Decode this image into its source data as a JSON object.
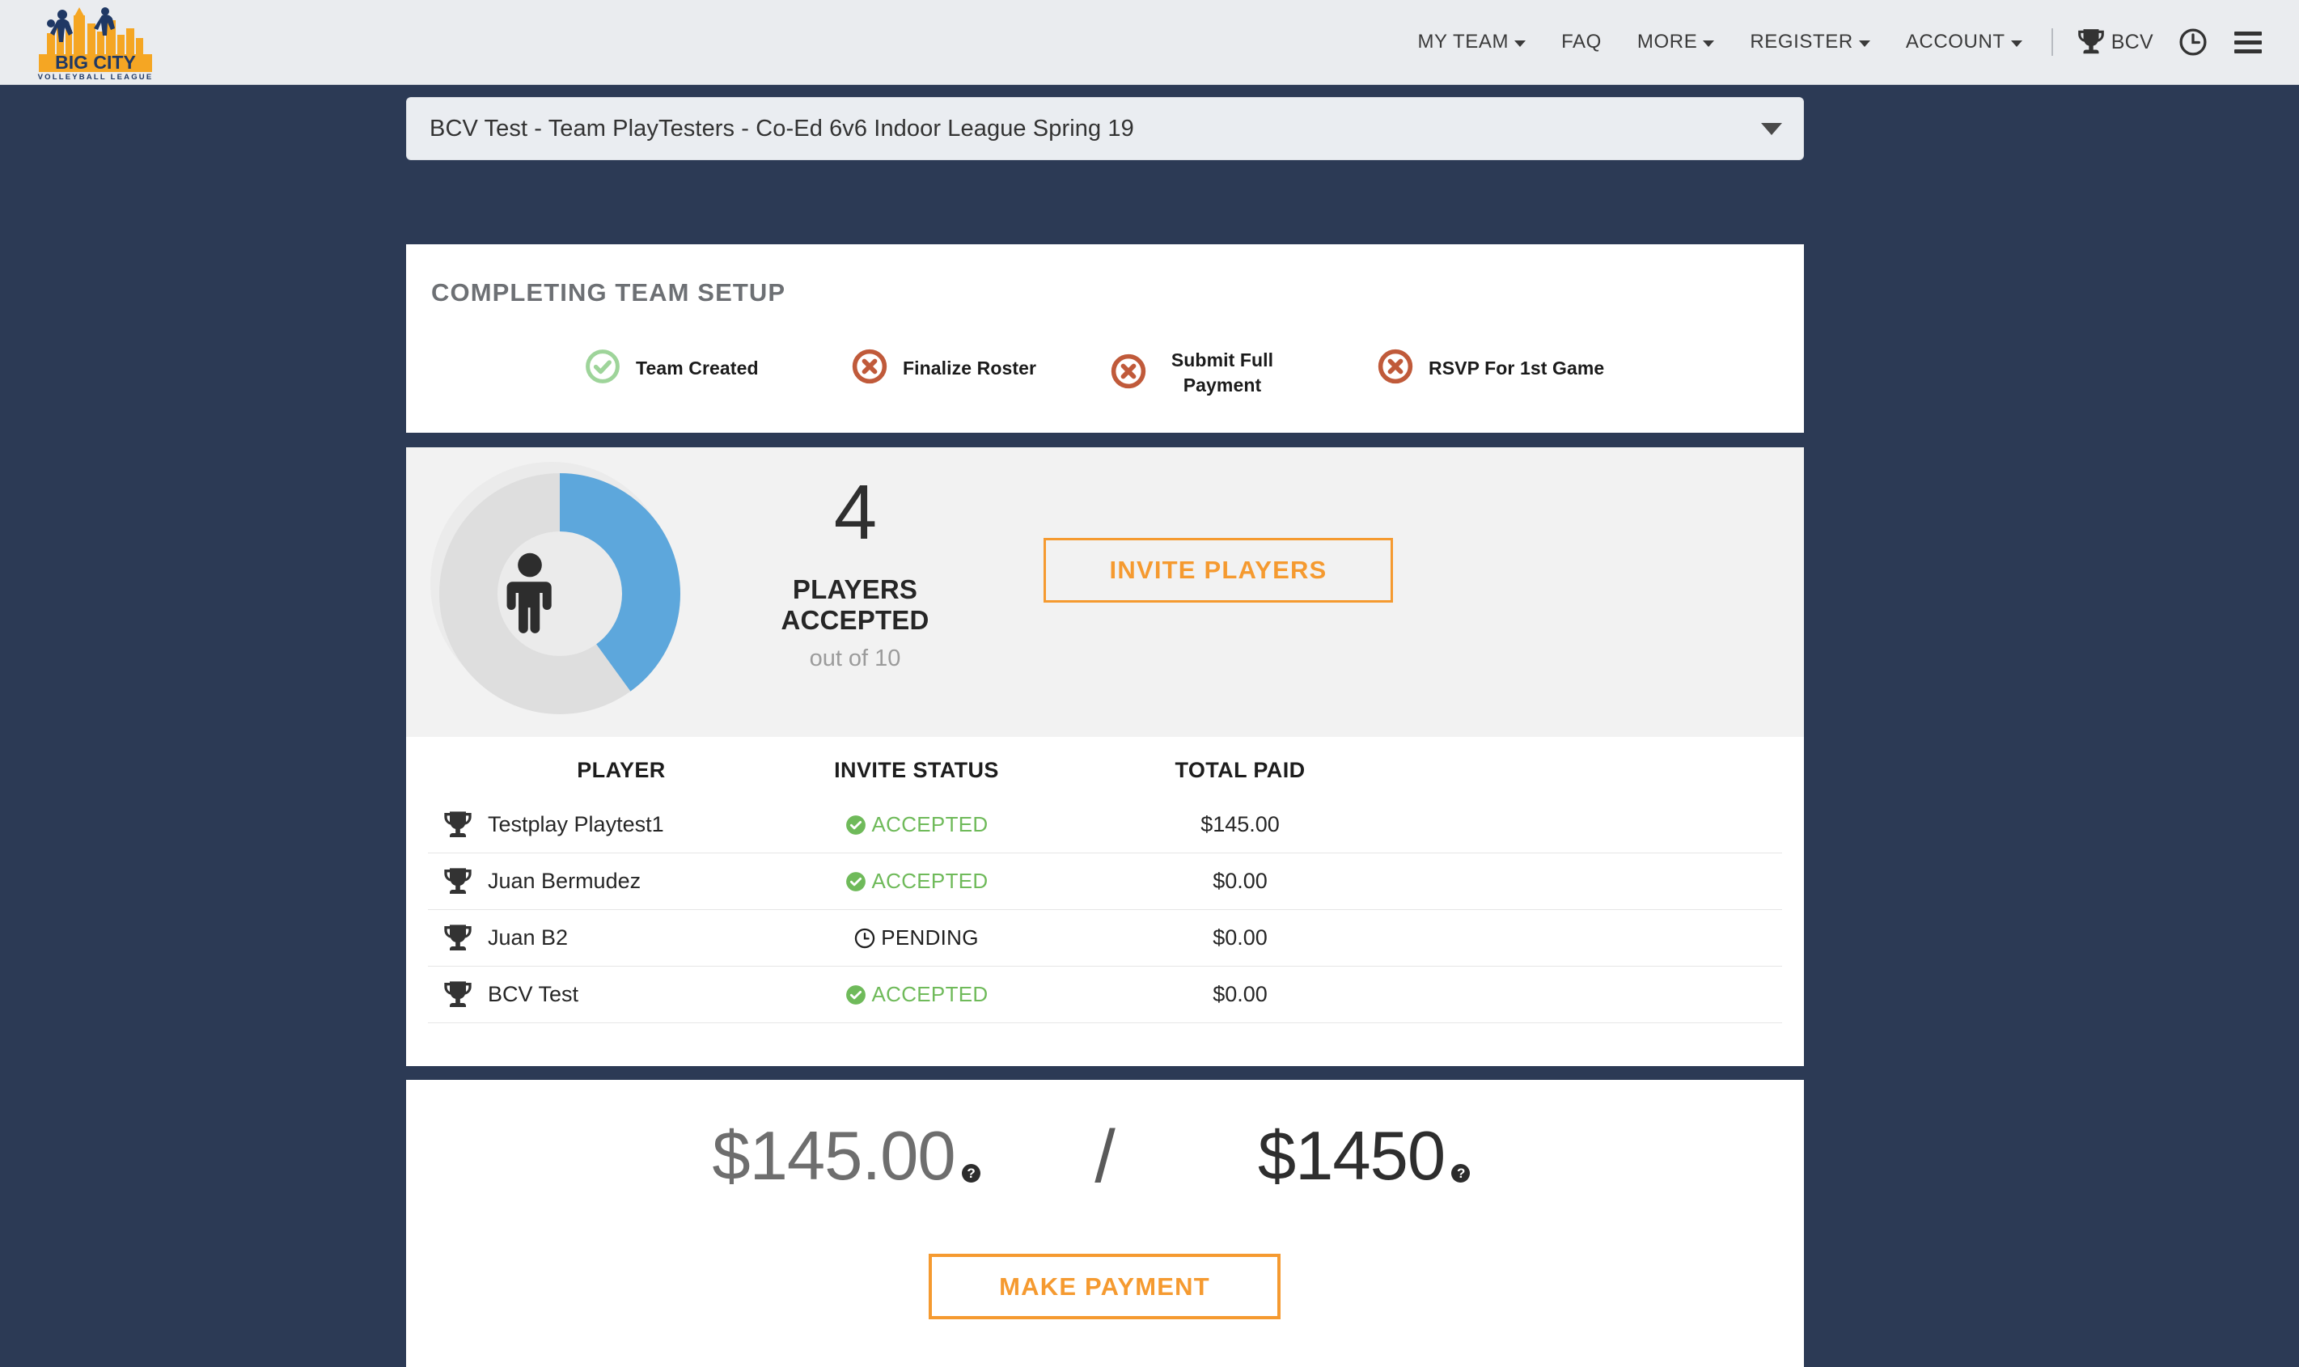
{
  "brand": {
    "name_line1": "BIG CITY",
    "name_line2": "VOLLEYBALL LEAGUE",
    "logo_gold": "#f5a623",
    "logo_navy": "#1f3864"
  },
  "nav": {
    "items": [
      {
        "label": "MY TEAM",
        "has_caret": true
      },
      {
        "label": "FAQ",
        "has_caret": false
      },
      {
        "label": "MORE",
        "has_caret": true
      },
      {
        "label": "REGISTER",
        "has_caret": true
      },
      {
        "label": "ACCOUNT",
        "has_caret": true
      }
    ],
    "user_badge": "BCV",
    "trophy_icon": "trophy-icon",
    "clock_icon": "clock-icon",
    "menu_icon": "hamburger-icon"
  },
  "team_select": {
    "value": "BCV Test - Team PlayTesters - Co-Ed 6v6 Indoor League Spring 19",
    "caret_icon": "chevron-down-icon"
  },
  "setup": {
    "title": "COMPLETING TEAM SETUP",
    "steps": [
      {
        "label": "Team Created",
        "state": "complete",
        "icon": "check-circle-icon",
        "color": "#9ed49a"
      },
      {
        "label": "Finalize Roster",
        "state": "incomplete",
        "icon": "x-circle-icon",
        "color": "#c05a3a"
      },
      {
        "label": "Submit Full Payment",
        "state": "incomplete",
        "icon": "x-circle-icon",
        "color": "#c05a3a"
      },
      {
        "label": "RSVP For 1st Game",
        "state": "incomplete",
        "icon": "x-circle-icon",
        "color": "#c05a3a"
      }
    ]
  },
  "roster": {
    "accepted_count": "4",
    "accepted_label": "PLAYERS ACCEPTED",
    "out_of_label": "out of 10",
    "invite_button": "INVITE PLAYERS",
    "accent_color": "#f59a30",
    "donut_color": "#5da7dc",
    "donut_track_color": "#dedede",
    "columns": [
      "PLAYER",
      "INVITE STATUS",
      "TOTAL PAID"
    ],
    "rows": [
      {
        "icon": "trophy-icon",
        "player": "Testplay Playtest1",
        "status": "ACCEPTED",
        "status_kind": "accepted",
        "paid": "$145.00"
      },
      {
        "icon": "trophy-icon",
        "player": "Juan Bermudez",
        "status": "ACCEPTED",
        "status_kind": "accepted",
        "paid": "$0.00"
      },
      {
        "icon": "trophy-icon",
        "player": "Juan B2",
        "status": "PENDING",
        "status_kind": "pending",
        "paid": "$0.00"
      },
      {
        "icon": "trophy-icon",
        "player": "BCV Test",
        "status": "ACCEPTED",
        "status_kind": "accepted",
        "paid": "$0.00"
      }
    ]
  },
  "payment": {
    "paid_amount": "$145.00",
    "separator": "/",
    "total_amount": "$1450",
    "help_glyph": "?",
    "make_payment_button": "MAKE PAYMENT"
  },
  "chart_data": {
    "type": "pie",
    "title": "PLAYERS ACCEPTED",
    "categories": [
      "Accepted",
      "Remaining"
    ],
    "values": [
      4,
      6
    ],
    "total": 10,
    "percent_filled": 40,
    "colors": [
      "#5da7dc",
      "#dedede"
    ],
    "center_label": "4",
    "subtitle": "out of 10"
  }
}
